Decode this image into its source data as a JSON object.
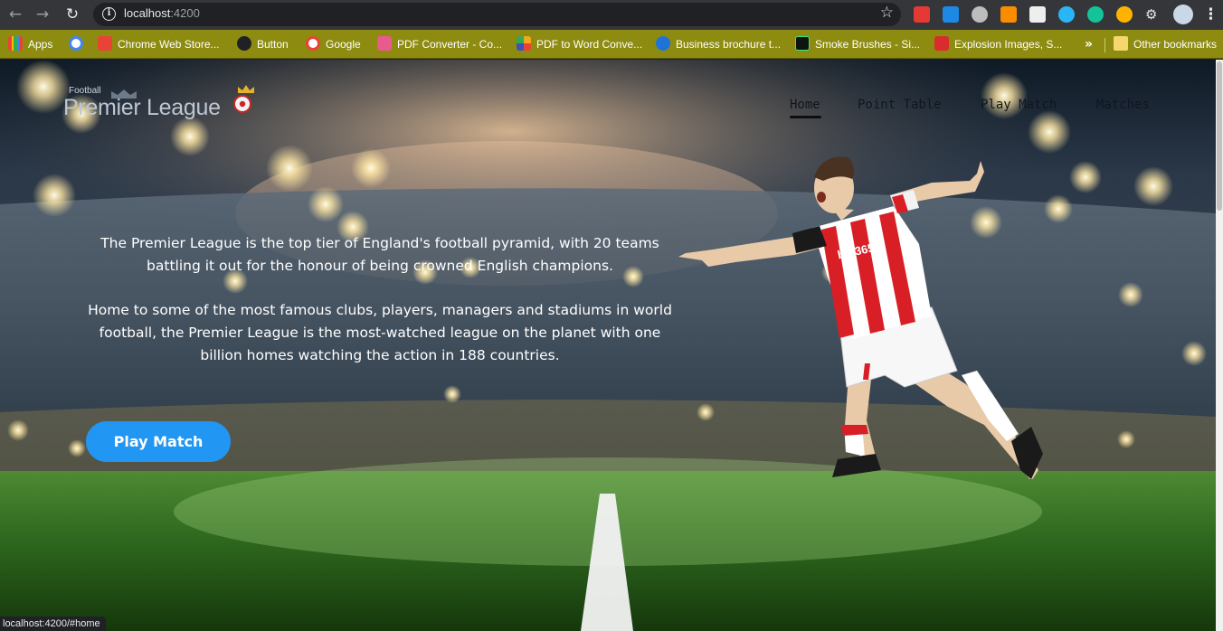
{
  "browser": {
    "url": "localhost",
    "port": ":4200",
    "status_url": "localhost:4200/#home",
    "bookmarks": [
      {
        "label": "Apps",
        "color": "#4285f4"
      },
      {
        "label": "Chrome Web Store...",
        "color": "#e84335"
      },
      {
        "label": "Button",
        "color": "#202124"
      },
      {
        "label": "Google",
        "color": "#ffffff"
      },
      {
        "label": "PDF Converter - Co...",
        "color": "#e95a8d"
      },
      {
        "label": "PDF to Word Conve...",
        "color": "#f2a81c"
      },
      {
        "label": "Business brochure t...",
        "color": "#1f73d8"
      },
      {
        "label": "Smoke Brushes - Si...",
        "color": "#10140f"
      },
      {
        "label": "Explosion Images, S...",
        "color": "#d92c2c"
      }
    ],
    "overflow_chevron": "»",
    "other_bookmarks": "Other bookmarks"
  },
  "site": {
    "logo_small": "Football",
    "logo_big": "Premier League",
    "nav": [
      "Home",
      "Point Table",
      "Play Match",
      "Matches"
    ],
    "active_nav": "Home",
    "paragraphs": [
      "The Premier League is the top tier of England's football pyramid, with 20 teams battling it out for the honour of being crowned English champions.",
      "Home to some of the most famous clubs, players, managers and stadiums in world football, the Premier League is the most-watched league on the planet with one billion homes watching the action in 188 countries."
    ],
    "cta_label": "Play Match",
    "jersey_text": "bet365"
  },
  "colors": {
    "accent": "#2296f3",
    "bookmark_bar": "#8d8b10",
    "kit_red": "#d81f26"
  }
}
